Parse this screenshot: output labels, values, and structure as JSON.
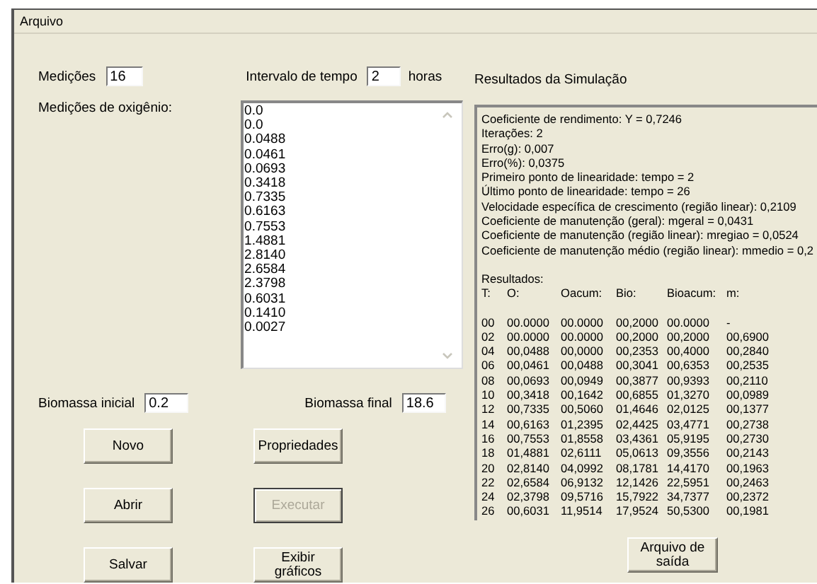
{
  "menu": [
    "Arquivo"
  ],
  "medicoes": {
    "label": "Medições",
    "value": "16"
  },
  "intervalo": {
    "label": "Intervalo de tempo",
    "value": "2",
    "unit": "horas"
  },
  "oxygen": {
    "label": "Medições de oxigênio:",
    "items": [
      "0.0",
      "0.0",
      "0.0488",
      "0.0461",
      "0.0693",
      "0.3418",
      "0.7335",
      "0.6163",
      "0.7553",
      "1.4881",
      "2.8140",
      "2.6584",
      "2.3798",
      "0.6031",
      "0.1410",
      "0.0027"
    ]
  },
  "biomassa_inicial": {
    "label": "Biomassa inicial",
    "value": "0.2"
  },
  "biomassa_final": {
    "label": "Biomassa final",
    "value": "18.6"
  },
  "buttons": [
    {
      "label": "Novo",
      "disabled": false
    },
    {
      "label": "Propriedades",
      "disabled": false
    },
    {
      "label": "Abrir",
      "disabled": false
    },
    {
      "label": "Executar",
      "disabled": true
    },
    {
      "label": "Salvar",
      "disabled": false
    },
    {
      "label": "Exibir gráficos",
      "disabled": false
    }
  ],
  "results": {
    "title": "Resultados da Simulação",
    "lines": [
      "Coeficiente de rendimento: Y = 0,7246",
      "Iterações: 2",
      "Erro(g): 0,007",
      "Erro(%): 0,0375",
      "Primeiro ponto de linearidade: tempo = 2",
      "Último ponto de linearidade: tempo = 26",
      "Velocidade específica de crescimento (região linear): 0,2109",
      "Coeficiente de manutenção (geral): mgeral = 0,0431",
      "Coeficiente de manutenção (região linear): mregiao = 0,0524",
      "Coeficiente de manutenção médio (região linear): mmedio = 0,2"
    ],
    "table_title": "Resultados:",
    "columns": [
      "T:",
      "O:",
      "Oacum:",
      "Bio:",
      "Bioacum:",
      "m:"
    ],
    "rows": [
      [
        "00",
        "00.0000",
        "00.0000",
        "00,2000",
        "00.0000",
        "-"
      ],
      [
        "02",
        "00.0000",
        "00.0000",
        "00,2000",
        "00,2000",
        "00,6900"
      ],
      [
        "04",
        "00,0488",
        "00,0000",
        "00,2353",
        "00,4000",
        "00,2840"
      ],
      [
        "06",
        "00,0461",
        "00,0488",
        "00,3041",
        "00,6353",
        "00,2535"
      ],
      [
        "08",
        "00,0693",
        "00,0949",
        "00,3877",
        "00,9393",
        "00,2110"
      ],
      [
        "10",
        "00,3418",
        "00,1642",
        "00,6855",
        "01,3270",
        "00,0989"
      ],
      [
        "12",
        "00,7335",
        "00,5060",
        "01,4646",
        "02,0125",
        "00,1377"
      ],
      [
        "14",
        "00,6163",
        "01,2395",
        "02,4425",
        "03,4771",
        "00,2738"
      ],
      [
        "16",
        "00,7553",
        "01,8558",
        "03,4361",
        "05,9195",
        "00,2730"
      ],
      [
        "18",
        "01,4881",
        "02,6111",
        "05,0613",
        "09,3556",
        "00,2143"
      ],
      [
        "20",
        "02,8140",
        "04,0992",
        "08,1781",
        "14,4170",
        "00,1963"
      ],
      [
        "22",
        "02,6584",
        "06,9132",
        "12,1426",
        "22,5951",
        "00,2463"
      ],
      [
        "24",
        "02,3798",
        "09,5716",
        "15,7922",
        "34,7377",
        "00,2372"
      ],
      [
        "26",
        "00,6031",
        "11,9514",
        "17,9524",
        "50,5300",
        "00,1981"
      ]
    ]
  },
  "output_button": {
    "label": "Arquivo de saída",
    "disabled": false
  }
}
